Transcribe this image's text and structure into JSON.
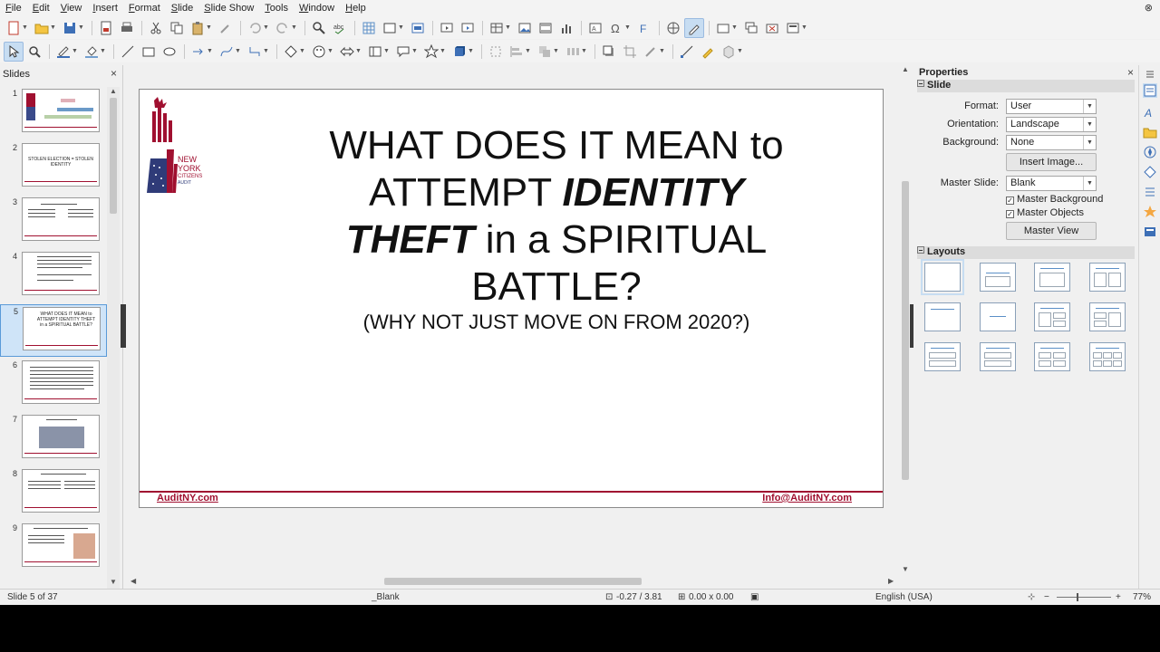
{
  "menubar": {
    "items": [
      "File",
      "Edit",
      "View",
      "Insert",
      "Format",
      "Slide",
      "Slide Show",
      "Tools",
      "Window",
      "Help"
    ],
    "close_glyph": "⊗"
  },
  "slides_pane": {
    "title": "Slides",
    "close_glyph": "×",
    "thumbnails": [
      {
        "num": "1",
        "text": ""
      },
      {
        "num": "2",
        "text": "STOLEN ELECTION = STOLEN IDENTITY"
      },
      {
        "num": "3",
        "text": ""
      },
      {
        "num": "4",
        "text": ""
      },
      {
        "num": "5",
        "text": "WHAT DOES IT MEAN to ATTEMPT IDENTITY THEFT in a SPIRITUAL BATTLE?"
      },
      {
        "num": "6",
        "text": ""
      },
      {
        "num": "7",
        "text": ""
      },
      {
        "num": "8",
        "text": ""
      },
      {
        "num": "9",
        "text": ""
      }
    ],
    "active_index": 4
  },
  "slide": {
    "title_line1": "WHAT DOES IT MEAN to",
    "title_line2a": "ATTEMPT ",
    "title_line2b": "IDENTITY",
    "title_line3a": "THEFT",
    "title_line3b": " in a SPIRITUAL",
    "title_line4": "BATTLE?",
    "subtitle": "(WHY NOT JUST MOVE ON FROM 2020?)",
    "logo_line1": "NEW",
    "logo_line2": "YORK",
    "logo_line3": "CITIZENS",
    "logo_line4": "AUDIT",
    "footer_left": "AuditNY.com",
    "footer_right": "Info@AuditNY.com",
    "accent_color": "#a01030"
  },
  "properties": {
    "title": "Properties",
    "close_glyph": "×",
    "slide_section": "Slide",
    "format_label": "Format:",
    "format_value": "User",
    "orientation_label": "Orientation:",
    "orientation_value": "Landscape",
    "background_label": "Background:",
    "background_value": "None",
    "insert_image_button": "Insert Image...",
    "master_slide_label": "Master Slide:",
    "master_slide_value": "Blank",
    "master_background_label": "Master Background",
    "master_background_checked": true,
    "master_objects_label": "Master Objects",
    "master_objects_checked": true,
    "master_view_button": "Master View",
    "layouts_section": "Layouts"
  },
  "statusbar": {
    "slide_position": "Slide 5 of 37",
    "master_name": "_Blank",
    "cursor_position": "-0.27 / 3.81",
    "object_size": "0.00 x 0.00",
    "language": "English (USA)",
    "zoom_minus": "−",
    "zoom_plus": "+",
    "zoom_level": "77%"
  }
}
